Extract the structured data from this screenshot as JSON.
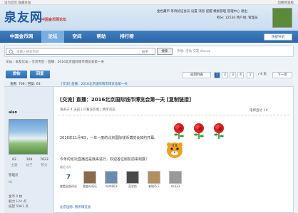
{
  "topbar": {
    "left": "设为首页  收藏本站",
    "right": "切换到宽版"
  },
  "logo": {
    "text": "泉友网",
    "slogan": "中国金币网论坛"
  },
  "user": {
    "links_row1": "金色藏币 等待验证会员  设置  消息  提醒  模板管理  管理中心  退出",
    "links_row2": "积分: 12530  用户组: 管理员"
  },
  "nav": {
    "items": [
      "中国金币网",
      "论坛",
      "空间",
      "帮助",
      "排行榜"
    ],
    "active_index": 1,
    "quick_nav": "快捷导航"
  },
  "search": {
    "placeholder": "请输入搜索内容",
    "scope": "帖子",
    "button": "搜索",
    "hot": "热搜: 活动 交友 discuz"
  },
  "breadcrumb": "论坛 › 泉友论坛 › 交流专区 › 直播：2016北京国际钱币博览会第一天",
  "actions": {
    "post": "发帖",
    "reply": "回复"
  },
  "pager": {
    "back": "返回列表",
    "pages": [
      "1",
      "2",
      "3",
      "4"
    ],
    "current": "1",
    "total": "/ 4 页",
    "next": "下一页"
  },
  "statbar": {
    "stats": "查看: 706 | 回复: 63",
    "tools": "[交流] 直播：2016北京国际钱币博览会第一天"
  },
  "author": {
    "name": "alan",
    "stat_values": [
      "62",
      "104",
      "7623"
    ],
    "stat_labels": [
      "主题",
      "帖子",
      "积分"
    ],
    "group": "管理员",
    "level": "N1",
    "info": [
      "金币  0 枚",
      "魅力  124 点",
      "威望  5961 点"
    ]
  },
  "post": {
    "title": "[交流] 直播：2016北京国际钱币博览会第一天 [复制链接]",
    "meta": "发表于 4 天前  |  只看该作者  |  倒序浏览",
    "floor": "电梯直达  1#",
    "p1": "2016年11月4日，一年一度的北京国际钱币博览会如约开幕。",
    "p2": "今年的论坛直播还是我来进行，欢迎各位朋友前来观展！",
    "visitors_title": "最近访问",
    "visitors": [
      "查看全部评分",
      "我爱外壳乐",
      "zem803",
      "范求信",
      "老钱币下",
      "sh333"
    ],
    "visitors_count": "7",
    "bottom_link": "北京国际, 钱币博览会"
  },
  "colors": {
    "brand": "#2a66a8",
    "nav": "#3f7fc0",
    "accent": "#c0392b"
  }
}
